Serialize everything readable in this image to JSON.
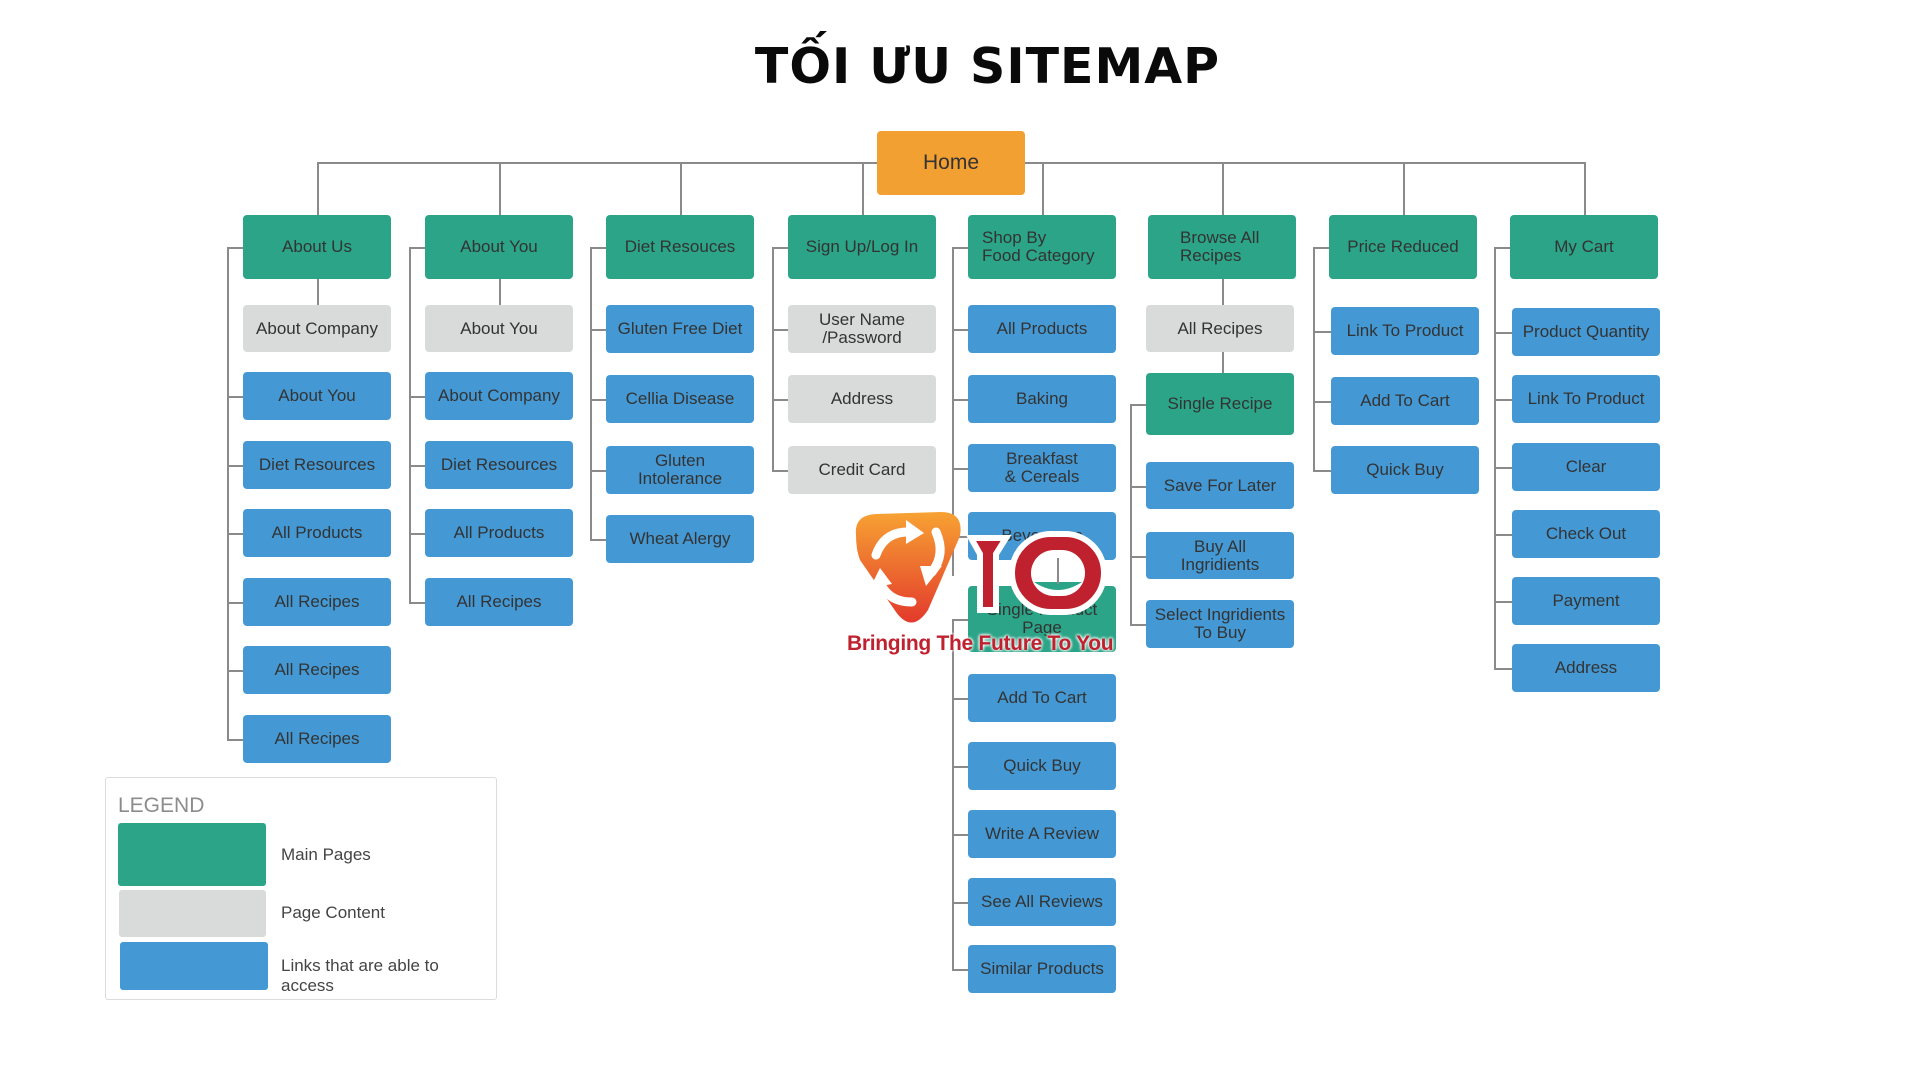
{
  "title": "TỐI ƯU SITEMAP",
  "colors": {
    "main": "#2ba487",
    "content": "#d8dbda",
    "link": "#4499d5",
    "home": "#f3a033",
    "connector": "#8a8a8a"
  },
  "home": {
    "label": "Home"
  },
  "columns": [
    {
      "header": "About Us",
      "children": [
        {
          "label": "About Company",
          "type": "content"
        },
        {
          "label": "About You",
          "type": "link"
        },
        {
          "label": "Diet Resources",
          "type": "link"
        },
        {
          "label": "All Products",
          "type": "link"
        },
        {
          "label": "All Recipes",
          "type": "link"
        },
        {
          "label": "All Recipes",
          "type": "link"
        },
        {
          "label": "All Recipes",
          "type": "link"
        }
      ]
    },
    {
      "header": "About You",
      "children": [
        {
          "label": "About You",
          "type": "content"
        },
        {
          "label": "About Company",
          "type": "link"
        },
        {
          "label": "Diet Resources",
          "type": "link"
        },
        {
          "label": "All Products",
          "type": "link"
        },
        {
          "label": "All Recipes",
          "type": "link"
        }
      ]
    },
    {
      "header": "Diet Resouces",
      "children": [
        {
          "label": "Gluten Free Diet",
          "type": "link"
        },
        {
          "label": "Cellia Disease",
          "type": "link"
        },
        {
          "label": "Gluten\nIntolerance",
          "type": "link"
        },
        {
          "label": "Wheat Alergy",
          "type": "link"
        }
      ]
    },
    {
      "header": "Sign Up/Log In",
      "children": [
        {
          "label": "User Name\n/Password",
          "type": "content"
        },
        {
          "label": "Address",
          "type": "content"
        },
        {
          "label": "Credit Card",
          "type": "content"
        }
      ]
    },
    {
      "header": "Shop By\nFood Category",
      "children": [
        {
          "label": "All Products",
          "type": "link"
        },
        {
          "label": "Baking",
          "type": "link"
        },
        {
          "label": "Breakfast\n& Cereals",
          "type": "link"
        },
        {
          "label": "Beverages",
          "type": "link"
        },
        {
          "label": "Single Product\nPage",
          "type": "main"
        },
        {
          "label": "Add To Cart",
          "type": "link"
        },
        {
          "label": "Quick Buy",
          "type": "link"
        },
        {
          "label": "Write A Review",
          "type": "link"
        },
        {
          "label": "See All Reviews",
          "type": "link"
        },
        {
          "label": "Similar Products",
          "type": "link"
        }
      ]
    },
    {
      "header": "Browse All\nRecipes",
      "children": [
        {
          "label": "All Recipes",
          "type": "content"
        },
        {
          "label": "Single Recipe",
          "type": "main"
        },
        {
          "label": "Save For Later",
          "type": "link"
        },
        {
          "label": "Buy All\nIngridients",
          "type": "link"
        },
        {
          "label": "Select Ingridients\nTo Buy",
          "type": "link"
        }
      ]
    },
    {
      "header": "Price Reduced",
      "children": [
        {
          "label": "Link To Product",
          "type": "link"
        },
        {
          "label": "Add To Cart",
          "type": "link"
        },
        {
          "label": "Quick Buy",
          "type": "link"
        }
      ]
    },
    {
      "header": "My Cart",
      "children": [
        {
          "label": "Product Quantity",
          "type": "link"
        },
        {
          "label": "Link To Product",
          "type": "link"
        },
        {
          "label": "Clear",
          "type": "link"
        },
        {
          "label": "Check Out",
          "type": "link"
        },
        {
          "label": "Payment",
          "type": "link"
        },
        {
          "label": "Address",
          "type": "link"
        }
      ]
    }
  ],
  "legend": {
    "title": "LEGEND",
    "items": [
      {
        "label": "Main Pages",
        "type": "main"
      },
      {
        "label": "Page Content",
        "type": "content"
      },
      {
        "label": "Links that are able to access",
        "type": "link"
      }
    ]
  },
  "watermark": {
    "logo_text": "iO",
    "tagline": "Bringing The Future To You"
  }
}
